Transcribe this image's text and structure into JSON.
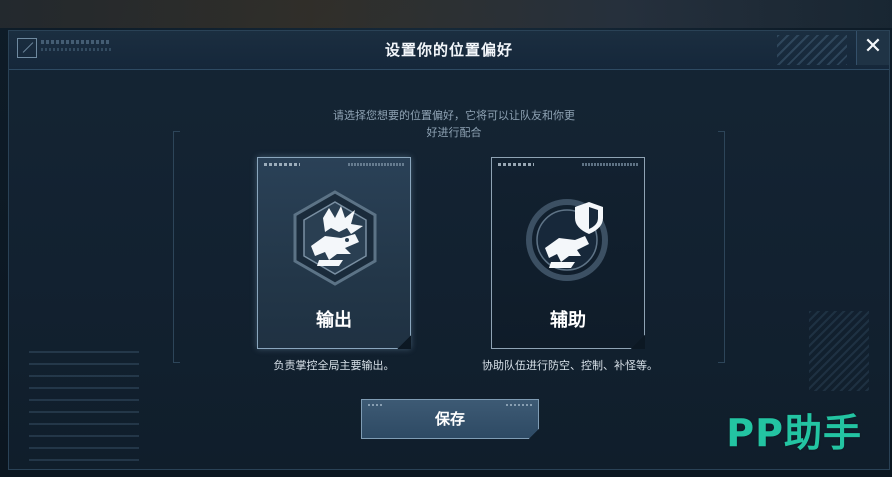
{
  "dialog": {
    "title": "设置你的位置偏好",
    "close_label": "✕",
    "description": "请选择您想要的位置偏好，它将可以让队友和你更好进行配合"
  },
  "roles": [
    {
      "label": "输出",
      "note": "负责掌控全局主要输出。",
      "selected": true,
      "icon": "dragon-burst-icon"
    },
    {
      "label": "辅助",
      "note": "协助队伍进行防空、控制、补怪等。",
      "selected": false,
      "icon": "dragon-shield-icon"
    }
  ],
  "save_label": "保存",
  "watermark": "PP助手",
  "colors": {
    "panel_bg": "#122130",
    "selected_card": "#2a4157",
    "accent_border": "#8aa6bd",
    "watermark": "#23c4a2"
  }
}
